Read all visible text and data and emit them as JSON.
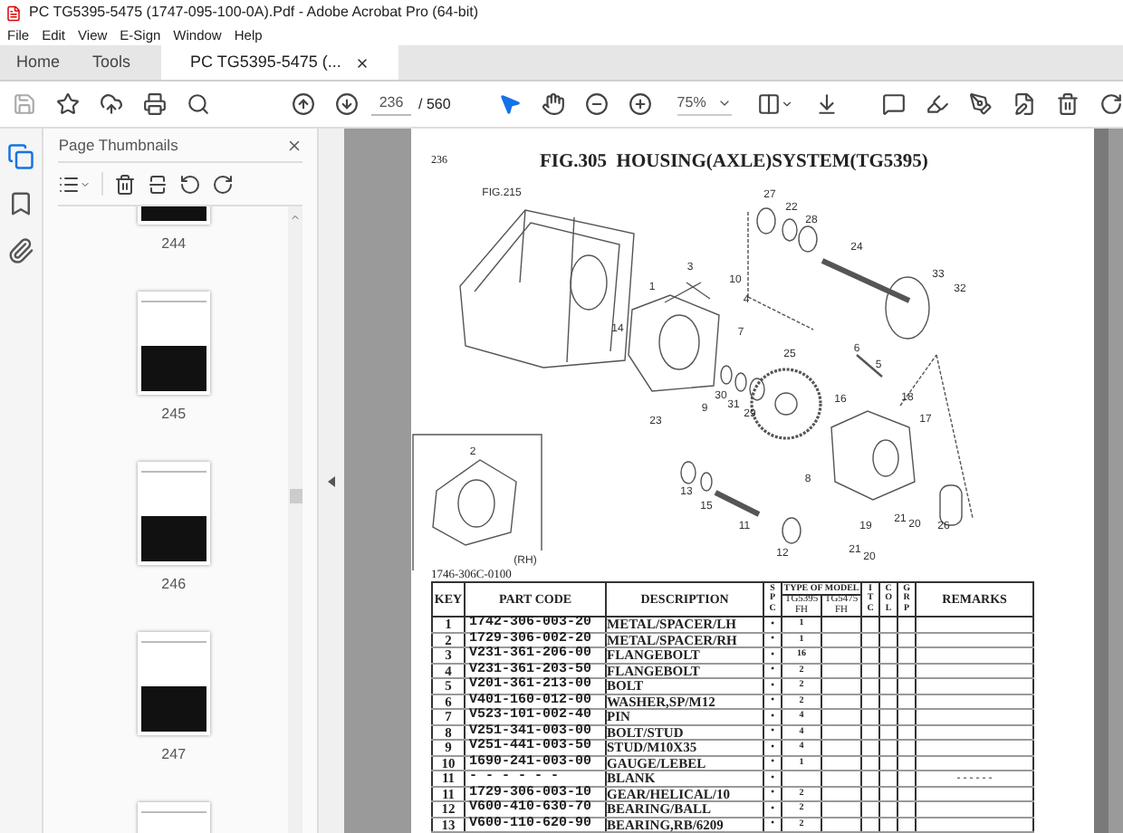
{
  "window": {
    "title": "PC TG5395-5475 (1747-095-100-0A).Pdf - Adobe Acrobat Pro (64-bit)"
  },
  "menu": [
    "File",
    "Edit",
    "View",
    "E-Sign",
    "Window",
    "Help"
  ],
  "tabs": [
    {
      "label": "Home",
      "selected": false,
      "closable": false
    },
    {
      "label": "Tools",
      "selected": false,
      "closable": false
    },
    {
      "label": "PC TG5395-5475 (...",
      "selected": true,
      "closable": true
    }
  ],
  "toolbar": {
    "page_value": "236",
    "page_total": "/ 560",
    "zoom": "75%"
  },
  "sidebar": {
    "title": "Page Thumbnails",
    "rail": [
      {
        "kind": "thumbnails",
        "selected": true
      },
      {
        "kind": "bookmarks",
        "selected": false
      },
      {
        "kind": "attachments",
        "selected": false
      }
    ],
    "thumbnails": [
      {
        "label": "244"
      },
      {
        "label": "245"
      },
      {
        "label": "246"
      },
      {
        "label": "247"
      }
    ]
  },
  "page": {
    "page_number": "236",
    "title": "FIG.305  HOUSING(AXLE)SYSTEM(TG5395)",
    "callouts": [
      "FIG.215",
      "27",
      "22",
      "28",
      "24",
      "33",
      "32",
      "3",
      "10",
      "4",
      "1",
      "14",
      "7",
      "25",
      "6",
      "5",
      "16",
      "18",
      "17",
      "30",
      "31",
      "29",
      "9",
      "23",
      "8",
      "2",
      "13",
      "15",
      "11",
      "12",
      "19",
      "21",
      "20",
      "21",
      "20",
      "26",
      "(RH)"
    ],
    "drawing_code": "1746-306C-0100",
    "table": {
      "columns": {
        "key": "KEY",
        "part_code": "PART CODE",
        "description": "DESCRIPTION",
        "spc": "SPC",
        "type_of_model": "TYPE OF MODEL",
        "models": [
          "TG5395 FH",
          "TG5475 FH"
        ],
        "itc": "ITC",
        "col": "COL",
        "grp": "GRP",
        "remarks": "REMARKS"
      },
      "rows": [
        {
          "key": "1",
          "part_code": "1742-306-003-20",
          "description": "METAL/SPACER/LH",
          "spc": "•",
          "qty": "1"
        },
        {
          "key": "2",
          "part_code": "1729-306-002-20",
          "description": "METAL/SPACER/RH",
          "spc": "•",
          "qty": "1"
        },
        {
          "key": "3",
          "part_code": "V231-361-206-00",
          "description": "FLANGEBOLT",
          "spc": "•",
          "qty": "16"
        },
        {
          "key": "4",
          "part_code": "V231-361-203-50",
          "description": "FLANGEBOLT",
          "spc": "•",
          "qty": "2"
        },
        {
          "key": "5",
          "part_code": "V201-361-213-00",
          "description": "BOLT",
          "spc": "•",
          "qty": "2"
        },
        {
          "key": "6",
          "part_code": "V401-160-012-00",
          "description": "WASHER,SP/M12",
          "spc": "•",
          "qty": "2"
        },
        {
          "key": "7",
          "part_code": "V523-101-002-40",
          "description": "PIN",
          "spc": "•",
          "qty": "4"
        },
        {
          "key": "8",
          "part_code": "V251-341-003-00",
          "description": "BOLT/STUD",
          "spc": "•",
          "qty": "4"
        },
        {
          "key": "9",
          "part_code": "V251-441-003-50",
          "description": "STUD/M10X35",
          "spc": "•",
          "qty": "4"
        },
        {
          "key": "10",
          "part_code": "1690-241-003-00",
          "description": "GAUGE/LEBEL",
          "spc": "•",
          "qty": "1"
        },
        {
          "key": "11",
          "part_code": "- - - - - -",
          "description": "BLANK",
          "spc": "•",
          "remarks": "- - - - - -"
        },
        {
          "key": "11",
          "part_code": "1729-306-003-10",
          "description": "GEAR/HELICAL/10",
          "spc": "•",
          "qty": "2"
        },
        {
          "key": "12",
          "part_code": "V600-410-630-70",
          "description": "BEARING/BALL",
          "spc": "•",
          "qty": "2"
        },
        {
          "key": "13",
          "part_code": "V600-110-620-90",
          "description": "BEARING,RB/6209",
          "spc": "•",
          "qty": "2"
        }
      ]
    }
  }
}
